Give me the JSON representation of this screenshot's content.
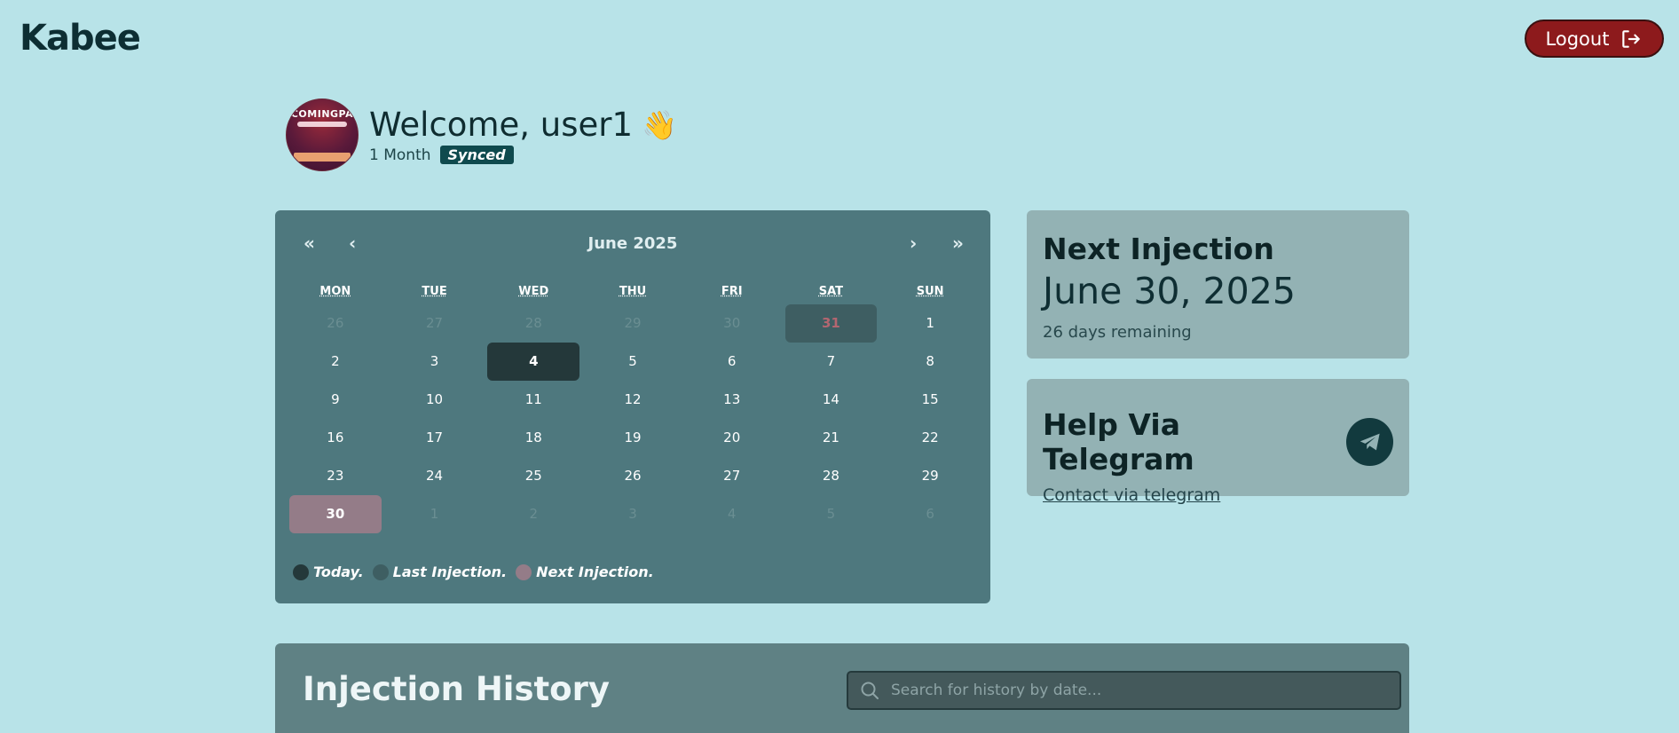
{
  "app": {
    "title": "Kabee"
  },
  "header": {
    "logout_label": "Logout"
  },
  "profile": {
    "avatar_text": "COMINGPA",
    "welcome": "Welcome, user1",
    "emoji": "👋",
    "plan": "1 Month",
    "status": "Synced"
  },
  "calendar": {
    "title": "June 2025",
    "nav": {
      "first": "«",
      "prev": "‹",
      "next": "›",
      "last": "»"
    },
    "weekdays": [
      "MON",
      "TUE",
      "WED",
      "THU",
      "FRI",
      "SAT",
      "SUN"
    ],
    "weeks": [
      [
        {
          "d": "26",
          "s": "dim"
        },
        {
          "d": "27",
          "s": "dim"
        },
        {
          "d": "28",
          "s": "dim"
        },
        {
          "d": "29",
          "s": "dim"
        },
        {
          "d": "30",
          "s": "dim"
        },
        {
          "d": "31",
          "s": "last"
        },
        {
          "d": "1",
          "s": ""
        }
      ],
      [
        {
          "d": "2",
          "s": ""
        },
        {
          "d": "3",
          "s": ""
        },
        {
          "d": "4",
          "s": "today"
        },
        {
          "d": "5",
          "s": ""
        },
        {
          "d": "6",
          "s": ""
        },
        {
          "d": "7",
          "s": ""
        },
        {
          "d": "8",
          "s": ""
        }
      ],
      [
        {
          "d": "9",
          "s": ""
        },
        {
          "d": "10",
          "s": ""
        },
        {
          "d": "11",
          "s": ""
        },
        {
          "d": "12",
          "s": ""
        },
        {
          "d": "13",
          "s": ""
        },
        {
          "d": "14",
          "s": ""
        },
        {
          "d": "15",
          "s": ""
        }
      ],
      [
        {
          "d": "16",
          "s": ""
        },
        {
          "d": "17",
          "s": ""
        },
        {
          "d": "18",
          "s": ""
        },
        {
          "d": "19",
          "s": ""
        },
        {
          "d": "20",
          "s": ""
        },
        {
          "d": "21",
          "s": ""
        },
        {
          "d": "22",
          "s": ""
        }
      ],
      [
        {
          "d": "23",
          "s": ""
        },
        {
          "d": "24",
          "s": ""
        },
        {
          "d": "25",
          "s": ""
        },
        {
          "d": "26",
          "s": ""
        },
        {
          "d": "27",
          "s": ""
        },
        {
          "d": "28",
          "s": ""
        },
        {
          "d": "29",
          "s": ""
        }
      ],
      [
        {
          "d": "30",
          "s": "next"
        },
        {
          "d": "1",
          "s": "dim"
        },
        {
          "d": "2",
          "s": "dim"
        },
        {
          "d": "3",
          "s": "dim"
        },
        {
          "d": "4",
          "s": "dim"
        },
        {
          "d": "5",
          "s": "dim"
        },
        {
          "d": "6",
          "s": "dim"
        }
      ]
    ],
    "legend": [
      {
        "label": "Today.",
        "color": "#24383a"
      },
      {
        "label": "Last Injection.",
        "color": "#3e5e62"
      },
      {
        "label": "Next Injection.",
        "color": "#947c88"
      }
    ]
  },
  "next_injection": {
    "heading": "Next Injection",
    "date": "June 30, 2025",
    "remaining": "26 days remaining"
  },
  "telegram": {
    "heading": "Help Via Telegram",
    "link": "Contact via telegram",
    "icon": "telegram-icon"
  },
  "history": {
    "heading": "Injection History",
    "search_placeholder": "Search for history by date..."
  },
  "colors": {
    "background": "#b8e3e8",
    "calendar_bg": "#4e787e",
    "card_bg": "#93b2b4",
    "logout_bg": "#8d1a1c",
    "badge_bg": "#0f4a4e"
  }
}
